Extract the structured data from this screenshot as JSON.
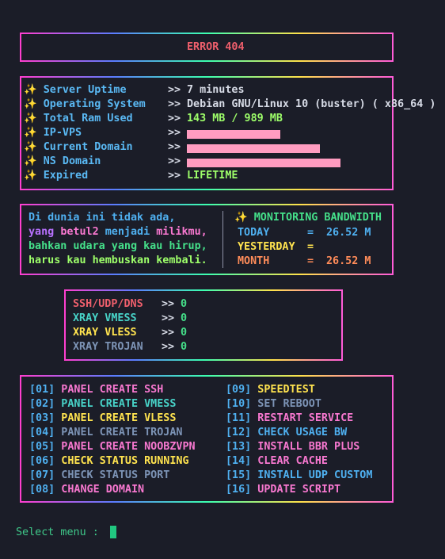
{
  "title": "ERROR 404",
  "sysinfo": [
    {
      "label": "Server Uptime",
      "arrow": ">>",
      "value": "7 minutes"
    },
    {
      "label": "Operating System",
      "arrow": ">>",
      "value": "Debian GNU/Linux 10 (buster) ( x86_64 )"
    },
    {
      "label": "Total Ram Used",
      "arrow": ">>",
      "value": "143 MB / 989 MB"
    },
    {
      "label": "IP-VPS",
      "arrow": ">>",
      "value": ""
    },
    {
      "label": "Current Domain",
      "arrow": ">>",
      "value": ""
    },
    {
      "label": "NS Domain",
      "arrow": ">>",
      "value": ""
    },
    {
      "label": "Expired",
      "arrow": ">>",
      "value": "LIFETIME"
    }
  ],
  "quote": [
    {
      "text": "Di dunia ini tidak ada,"
    },
    {
      "parts": [
        "yang ",
        "betul2",
        " menjadi ",
        "milikmu,"
      ]
    },
    {
      "text": "bahkan udara yang kau hirup,"
    },
    {
      "text": "harus kau hembuskan kembali."
    }
  ],
  "bandwidth": {
    "title": "MONITORING BANDWIDTH",
    "rows": [
      {
        "label": "TODAY",
        "eq": "=",
        "value": "26.52 M"
      },
      {
        "label": "YESTERDAY",
        "eq": "=",
        "value": ""
      },
      {
        "label": "MONTH",
        "eq": "=",
        "value": "26.52 M"
      }
    ]
  },
  "accounts": [
    {
      "label": "SSH/UDP/DNS",
      "arrow": ">>",
      "count": "0"
    },
    {
      "label": "XRAY VMESS",
      "arrow": ">>",
      "count": "0"
    },
    {
      "label": "XRAY VLESS",
      "arrow": ">>",
      "count": "0"
    },
    {
      "label": "XRAY TROJAN",
      "arrow": ">>",
      "count": "0"
    }
  ],
  "menu_left": [
    {
      "num": "[01]",
      "label": "PANEL CREATE SSH"
    },
    {
      "num": "[02]",
      "label": "PANEL CREATE VMESS"
    },
    {
      "num": "[03]",
      "label": "PANEL CREATE VLESS"
    },
    {
      "num": "[04]",
      "label": "PANEL CREATE TROJAN"
    },
    {
      "num": "[05]",
      "label": "PANEL CREATE NOOBZVPN"
    },
    {
      "num": "[06]",
      "label": "CHECK STATUS RUNNING"
    },
    {
      "num": "[07]",
      "label": "CHECK STATUS PORT"
    },
    {
      "num": "[08]",
      "label": "CHANGE DOMAIN"
    }
  ],
  "menu_right": [
    {
      "num": "[09]",
      "label": "SPEEDTEST"
    },
    {
      "num": "[10]",
      "label": "SET REBOOT"
    },
    {
      "num": "[11]",
      "label": "RESTART SERVICE"
    },
    {
      "num": "[12]",
      "label": "CHECK USAGE BW"
    },
    {
      "num": "[13]",
      "label": "INSTALL BBR PLUS"
    },
    {
      "num": "[14]",
      "label": "CLEAR CACHE"
    },
    {
      "num": "[15]",
      "label": "INSTALL UDP CUSTOM"
    },
    {
      "num": "[16]",
      "label": "UPDATE SCRIPT"
    }
  ],
  "prompt": "Select menu :",
  "sparkle_icon": "sparkles-icon"
}
